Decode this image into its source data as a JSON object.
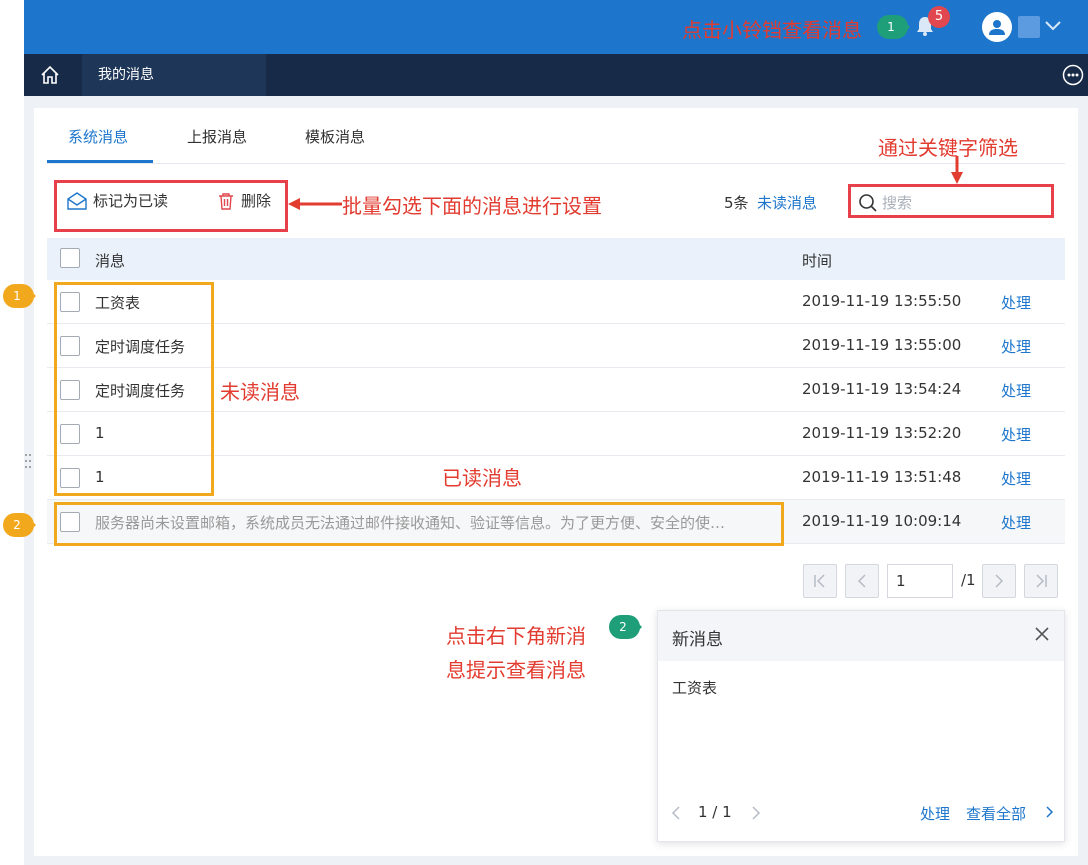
{
  "header": {
    "notification_count": "5",
    "bell_annotation": "点击小铃铛查看消息",
    "bell_annotation_pin": "1"
  },
  "nav": {
    "tab_label": "我的消息"
  },
  "tabs": [
    {
      "label": "系统消息",
      "active": true
    },
    {
      "label": "上报消息",
      "active": false
    },
    {
      "label": "模板消息",
      "active": false
    }
  ],
  "toolbar": {
    "mark_read_label": "标记为已读",
    "delete_label": "删除",
    "count_text": "5条",
    "unread_link": "未读消息",
    "search_placeholder": "搜索"
  },
  "table": {
    "columns": {
      "message": "消息",
      "time": "时间"
    },
    "rows": [
      {
        "name": "工资表",
        "time": "2019-11-19 13:55:50",
        "action": "处理",
        "read": false
      },
      {
        "name": "定时调度任务",
        "time": "2019-11-19 13:55:00",
        "action": "处理",
        "read": false
      },
      {
        "name": "定时调度任务",
        "time": "2019-11-19 13:54:24",
        "action": "处理",
        "read": false
      },
      {
        "name": "1",
        "time": "2019-11-19 13:52:20",
        "action": "处理",
        "read": false
      },
      {
        "name": "1",
        "time": "2019-11-19 13:51:48",
        "action": "处理",
        "read": false
      },
      {
        "name": "服务器尚未设置邮箱，系统成员无法通过邮件接收通知、验证等信息。为了更方便、安全的使…",
        "time": "2019-11-19 10:09:14",
        "action": "处理",
        "read": true
      }
    ]
  },
  "pagination": {
    "current": "1",
    "total": "/1"
  },
  "popup": {
    "title": "新消息",
    "body": "工资表",
    "page": "1 / 1",
    "handle": "处理",
    "view_all": "查看全部"
  },
  "annotations": {
    "batch": "批量勾选下面的消息进行设置",
    "keyword": "通过关键字筛选",
    "unread": "未读消息",
    "read": "已读消息",
    "popup_line1": "点击右下角新消",
    "popup_line2": "息提示查看消息",
    "pin_unread": "1",
    "pin_read": "2",
    "pin_popup": "2"
  },
  "colors": {
    "topbar": "#1e76cc",
    "navbar": "#172a47",
    "link": "#1e76cc",
    "annotation_red": "#e23b2f",
    "annotation_orange": "#f2a81d",
    "pin_green": "#1e9e79",
    "pin_orange": "#f2a81d"
  }
}
